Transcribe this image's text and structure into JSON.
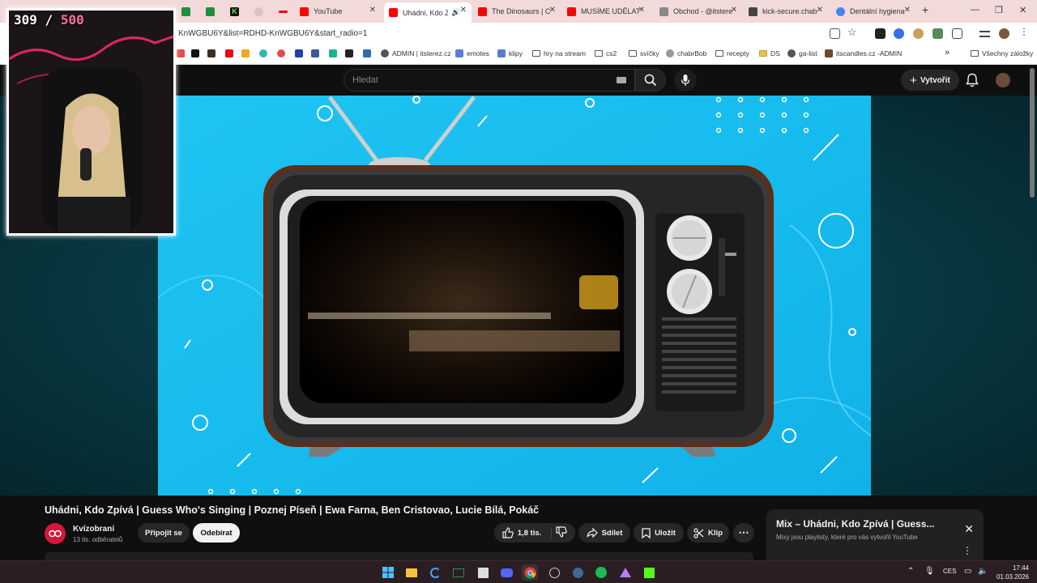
{
  "browser": {
    "tabs": [
      {
        "title": "",
        "favicon_color": "#1e8e3e",
        "active": false
      },
      {
        "title": "",
        "favicon_color": "#1e8e3e",
        "active": false
      },
      {
        "title": "",
        "favicon_color": "#53fc18",
        "active": false
      },
      {
        "title": "",
        "favicon_color": "#c7b2b2",
        "active": false
      },
      {
        "title": "",
        "favicon_color": "#e60023",
        "active": false
      },
      {
        "title": "YouTube",
        "favicon_color": "#ff0000",
        "active": false
      },
      {
        "title": "Uhádni, Kdo Z",
        "favicon_color": "#ff0000",
        "active": true
      },
      {
        "title": "The Dinosaurs | C",
        "favicon_color": "#ff0000",
        "active": false
      },
      {
        "title": "MUSÍME UDĚLAT",
        "favicon_color": "#ff0000",
        "active": false
      },
      {
        "title": "Obchod - @itstere",
        "favicon_color": "#888888",
        "active": false
      },
      {
        "title": "kick-secure.chab",
        "favicon_color": "#444444",
        "active": false
      },
      {
        "title": "Dentální hygiena",
        "favicon_color": "#4285f4",
        "active": false
      }
    ],
    "url": "KnWGBU6Y&list=RDHD-KnWGBU6Y&start_radio=1",
    "bookmarks": [
      {
        "label": "",
        "icon": "x-icon"
      },
      {
        "label": "",
        "icon": "app-icon"
      },
      {
        "label": "",
        "icon": "netflix-icon"
      },
      {
        "label": "",
        "icon": "app-icon"
      },
      {
        "label": "",
        "icon": "app-icon"
      },
      {
        "label": "",
        "icon": "app-icon"
      },
      {
        "label": "",
        "icon": "app-icon"
      },
      {
        "label": "",
        "icon": "app-icon"
      },
      {
        "label": "",
        "icon": "app-icon"
      },
      {
        "label": "",
        "icon": "app-icon"
      },
      {
        "label": "",
        "icon": "app-icon"
      },
      {
        "label": "ADMIN | itsterez.cz",
        "icon": "site-icon"
      },
      {
        "label": "emotes",
        "icon": "site-icon"
      },
      {
        "label": "klipy",
        "icon": "site-icon"
      },
      {
        "label": "hry na stream",
        "icon": "folder-icon"
      },
      {
        "label": "cs2",
        "icon": "folder-icon"
      },
      {
        "label": "svíčky",
        "icon": "folder-icon"
      },
      {
        "label": "chabrBob",
        "icon": "site-icon"
      },
      {
        "label": "recepty",
        "icon": "folder-icon"
      },
      {
        "label": "DS",
        "icon": "folder-icon"
      },
      {
        "label": "ga-list",
        "icon": "site-icon"
      },
      {
        "label": "itscandles.cz -ADMIN",
        "icon": "site-icon"
      }
    ],
    "all_bookmarks": "Všechny záložky"
  },
  "youtube": {
    "search_placeholder": "Hledat",
    "create_label": "Vytvořit",
    "video_title": "Uhádni, Kdo Zpívá | Guess Who's Singing | Poznej Píseň | Ewa Farna, Ben Cristovao, Lucie Bílá, Pokáč",
    "channel_name": "Kvízobraní",
    "channel_subs": "13 tis. odběratelů",
    "join_label": "Připojit se",
    "subscribe_label": "Odebírat",
    "like_count": "1,8 tis.",
    "share_label": "Sdílet",
    "save_label": "Uložit",
    "clip_label": "Klip",
    "mix_title": "Mix – Uhádni, Kdo Zpívá | Guess...",
    "mix_subtitle": "Mixy jsou playlisty, které pro vás vytvořil YouTube"
  },
  "overlay": {
    "count_current": "309",
    "count_sep": "/",
    "count_total": "500"
  },
  "taskbar": {
    "lang": "CES",
    "time": "17:44",
    "date": "01.03.2026"
  },
  "colors": {
    "player_bg": "#14b8ec",
    "accent_red": "#ff0000",
    "counter_total": "#ff6fa6"
  }
}
